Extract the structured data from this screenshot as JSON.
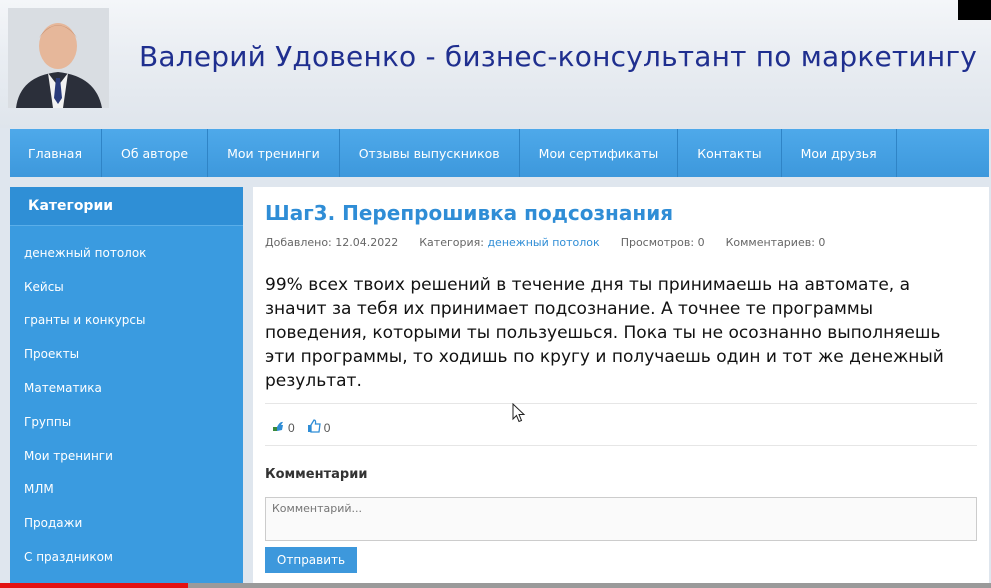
{
  "header": {
    "title": "Валерий Удовенко - бизнес-консультант по маркетингу"
  },
  "nav": {
    "items": [
      "Главная",
      "Об авторе",
      "Мои тренинги",
      "Отзывы выпускников",
      "Мои сертификаты",
      "Контакты",
      "Мои друзья"
    ]
  },
  "sidebar": {
    "title": "Категории",
    "items": [
      "денежный потолок",
      "Кейсы",
      "гранты и конкурсы",
      "Проекты",
      "Математика",
      "Группы",
      "Мои тренинги",
      "МЛМ",
      "Продажи",
      "С праздником"
    ]
  },
  "article": {
    "title": "Шаг3. Перепрошивка подсознания",
    "meta": {
      "added_label": "Добавлено:",
      "added_date": "12.04.2022",
      "category_label": "Категория:",
      "category": "денежный потолок",
      "views_label": "Просмотров:",
      "views": "0",
      "comments_label": "Комментариев:",
      "comments": "0"
    },
    "body": "99% всех твоих решений в течение дня ты принимаешь на автомате, а значит за тебя их принимает подсознание. А точнее те программы поведения, которыми ты пользуешься. Пока ты не осознанно выполняешь эти программы, то ходишь по кругу и получаешь один и тот же денежный результат.",
    "votes": {
      "share_count": "0",
      "like_count": "0"
    }
  },
  "comments": {
    "title": "Комментарии",
    "placeholder": "Комментарий...",
    "submit_label": "Отправить"
  },
  "video_progress": 0.19,
  "colors": {
    "accent": "#3d98dc",
    "title": "#1f2f8f",
    "link": "#2f8dd6",
    "progress": "#e31212"
  }
}
